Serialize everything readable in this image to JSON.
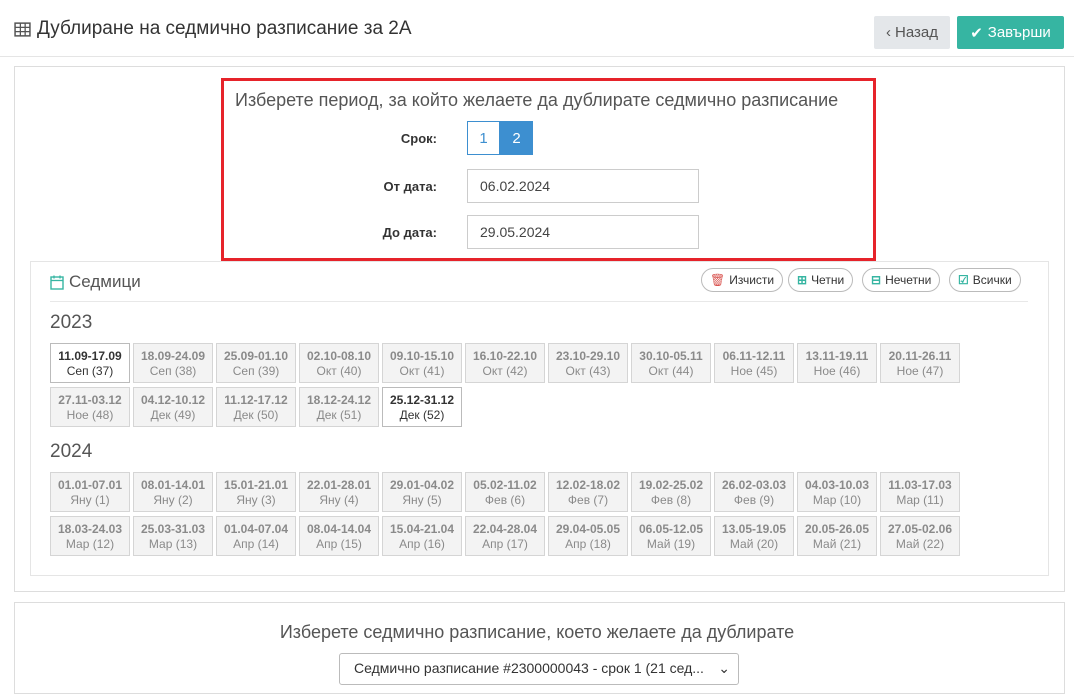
{
  "header": {
    "title": "Дублиране на седмично разписание за 2А",
    "back_label": "Назад",
    "finish_label": "Завърши"
  },
  "period": {
    "title": "Изберете период, за който желаете да дублирате седмично разписание",
    "term_label": "Срок:",
    "terms": [
      "1",
      "2"
    ],
    "selected_term": "2",
    "from_label": "От дата:",
    "from_value": "06.02.2024",
    "to_label": "До дата:",
    "to_value": "29.05.2024"
  },
  "weeks": {
    "title": "Седмици",
    "actions": {
      "clear": "Изчисти",
      "even": "Четни",
      "odd": "Нечетни",
      "all": "Всички"
    },
    "years": [
      {
        "year": "2023",
        "items": [
          {
            "range": "11.09-17.09",
            "month": "Сеп (37)",
            "active": true
          },
          {
            "range": "18.09-24.09",
            "month": "Сеп (38)",
            "active": false
          },
          {
            "range": "25.09-01.10",
            "month": "Сеп (39)",
            "active": false
          },
          {
            "range": "02.10-08.10",
            "month": "Окт (40)",
            "active": false
          },
          {
            "range": "09.10-15.10",
            "month": "Окт (41)",
            "active": false
          },
          {
            "range": "16.10-22.10",
            "month": "Окт (42)",
            "active": false
          },
          {
            "range": "23.10-29.10",
            "month": "Окт (43)",
            "active": false
          },
          {
            "range": "30.10-05.11",
            "month": "Окт (44)",
            "active": false
          },
          {
            "range": "06.11-12.11",
            "month": "Ное (45)",
            "active": false
          },
          {
            "range": "13.11-19.11",
            "month": "Ное (46)",
            "active": false
          },
          {
            "range": "20.11-26.11",
            "month": "Ное (47)",
            "active": false
          },
          {
            "range": "27.11-03.12",
            "month": "Ное (48)",
            "active": false
          },
          {
            "range": "04.12-10.12",
            "month": "Дек (49)",
            "active": false
          },
          {
            "range": "11.12-17.12",
            "month": "Дек (50)",
            "active": false
          },
          {
            "range": "18.12-24.12",
            "month": "Дек (51)",
            "active": false
          },
          {
            "range": "25.12-31.12",
            "month": "Дек (52)",
            "active": true
          }
        ]
      },
      {
        "year": "2024",
        "items": [
          {
            "range": "01.01-07.01",
            "month": "Яну (1)",
            "active": false
          },
          {
            "range": "08.01-14.01",
            "month": "Яну (2)",
            "active": false
          },
          {
            "range": "15.01-21.01",
            "month": "Яну (3)",
            "active": false
          },
          {
            "range": "22.01-28.01",
            "month": "Яну (4)",
            "active": false
          },
          {
            "range": "29.01-04.02",
            "month": "Яну (5)",
            "active": false
          },
          {
            "range": "05.02-11.02",
            "month": "Фев (6)",
            "active": false
          },
          {
            "range": "12.02-18.02",
            "month": "Фев (7)",
            "active": false
          },
          {
            "range": "19.02-25.02",
            "month": "Фев (8)",
            "active": false
          },
          {
            "range": "26.02-03.03",
            "month": "Фев (9)",
            "active": false
          },
          {
            "range": "04.03-10.03",
            "month": "Мар (10)",
            "active": false
          },
          {
            "range": "11.03-17.03",
            "month": "Мар (11)",
            "active": false
          },
          {
            "range": "18.03-24.03",
            "month": "Мар (12)",
            "active": false
          },
          {
            "range": "25.03-31.03",
            "month": "Мар (13)",
            "active": false
          },
          {
            "range": "01.04-07.04",
            "month": "Апр (14)",
            "active": false
          },
          {
            "range": "08.04-14.04",
            "month": "Апр (15)",
            "active": false
          },
          {
            "range": "15.04-21.04",
            "month": "Апр (16)",
            "active": false
          },
          {
            "range": "22.04-28.04",
            "month": "Апр (17)",
            "active": false
          },
          {
            "range": "29.04-05.05",
            "month": "Апр (18)",
            "active": false
          },
          {
            "range": "06.05-12.05",
            "month": "Май (19)",
            "active": false
          },
          {
            "range": "13.05-19.05",
            "month": "Май (20)",
            "active": false
          },
          {
            "range": "20.05-26.05",
            "month": "Май (21)",
            "active": false
          },
          {
            "range": "27.05-02.06",
            "month": "Май (22)",
            "active": false
          }
        ]
      }
    ]
  },
  "schedule": {
    "title": "Изберете седмично разписание, което желаете да дублирате",
    "select_value": "Седмично разписание #2300000043 - срок 1 (21 сед..."
  },
  "colors": {
    "accent": "#36b5a2",
    "primary": "#3d8fd0",
    "highlight": "#e6232a"
  }
}
